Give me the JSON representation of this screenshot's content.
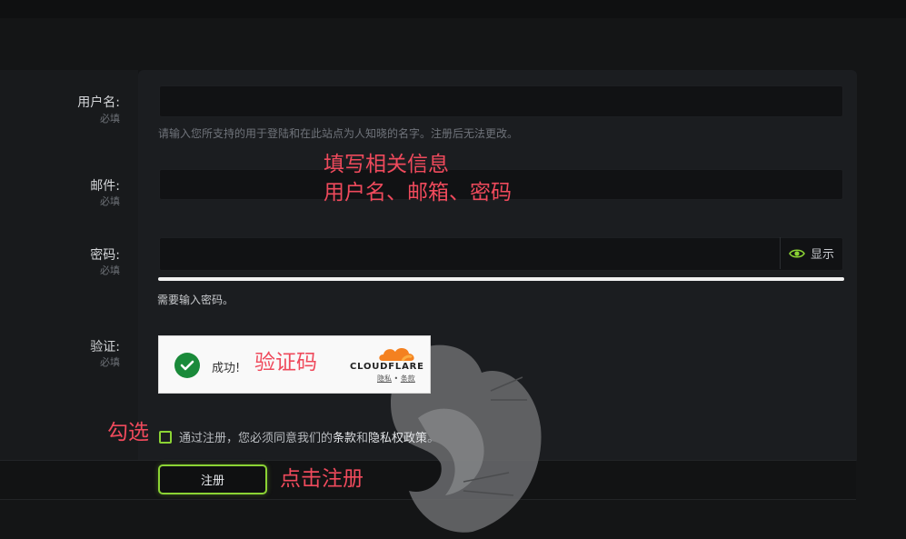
{
  "form": {
    "username": {
      "label": "用户名:",
      "required": "必填",
      "hint": "请输入您所支持的用于登陆和在此站点为人知晓的名字。注册后无法更改。",
      "value": ""
    },
    "email": {
      "label": "邮件:",
      "required": "必填",
      "value": ""
    },
    "password": {
      "label": "密码:",
      "required": "必填",
      "value": "",
      "show_label": "显示",
      "strength_message": "需要输入密码。"
    },
    "captcha": {
      "label": "验证:",
      "required": "必填",
      "status": "成功!",
      "brand": "CLOUDFLARE",
      "privacy": "隐私",
      "separator": "•",
      "terms": "条款"
    },
    "agreement": {
      "prefix": "通过注册，您必须同意我们的",
      "terms": "条款",
      "and": "和",
      "privacy": "隐私权政策",
      "suffix": "。"
    },
    "register_button": "注册"
  },
  "annotations": {
    "fill_line1": "填写相关信息",
    "fill_line2": "用户名、邮箱、密码",
    "captcha": "验证码",
    "check": "勾选",
    "click": "点击注册"
  },
  "colors": {
    "accent": "#8bd334",
    "annotation": "#ef4a5c",
    "captcha_success": "#1a8a3a",
    "cloudflare": "#f48120"
  }
}
